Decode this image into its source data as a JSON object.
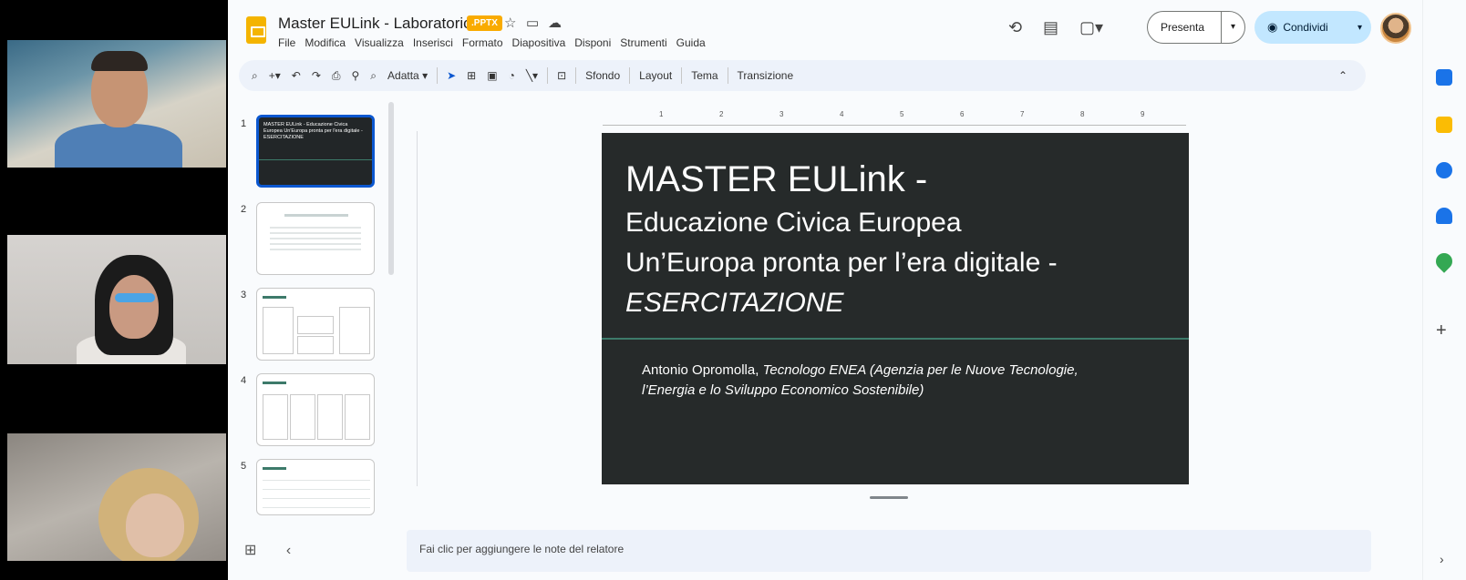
{
  "app": {
    "doc_title": "Master EULink - Laboratorio",
    "file_badge": ".PPTX",
    "menu": [
      "File",
      "Modifica",
      "Visualizza",
      "Inserisci",
      "Formato",
      "Diapositiva",
      "Disponi",
      "Strumenti",
      "Guida"
    ],
    "present_label": "Presenta",
    "share_label": "Condividi"
  },
  "toolbar": {
    "zoom_label": "Adatta",
    "background_label": "Sfondo",
    "layout_label": "Layout",
    "theme_label": "Tema",
    "transition_label": "Transizione"
  },
  "filmstrip": {
    "slide_numbers": [
      "1",
      "2",
      "3",
      "4",
      "5"
    ],
    "thumb1_title": "MASTER EULink - Educazione Civica Europea Un'Europa pronta per l'era digitale - ESERCITAZIONE"
  },
  "ruler_ticks": [
    "1",
    "2",
    "3",
    "4",
    "5",
    "6",
    "7",
    "8",
    "9"
  ],
  "slide": {
    "title": "MASTER EULink -",
    "line2": "Educazione Civica Europea",
    "line3": "Un’Europa pronta per l’era digitale -",
    "line4": "ESERCITAZIONE",
    "author_name": "Antonio Opromolla,",
    "author_role": "Tecnologo ENEA (Agenzia per le Nuove Tecnologie, l’Energia e lo Sviluppo Economico Sostenibile)"
  },
  "notes": {
    "placeholder": "Fai clic per aggiungere le note del relatore"
  },
  "colors": {
    "accent_blue": "#0b57d0",
    "share_bg": "#c2e7ff",
    "slide_bg": "#262a2a",
    "slide_divider": "#3d7a6a",
    "badge_orange": "#f9ab00"
  },
  "icons": {
    "video_tiles": [
      "participant-video-1",
      "participant-video-2",
      "participant-video-3"
    ],
    "side_panel": [
      "calendar-icon",
      "keep-icon",
      "tasks-icon",
      "contacts-icon",
      "maps-icon",
      "plus-icon"
    ]
  }
}
